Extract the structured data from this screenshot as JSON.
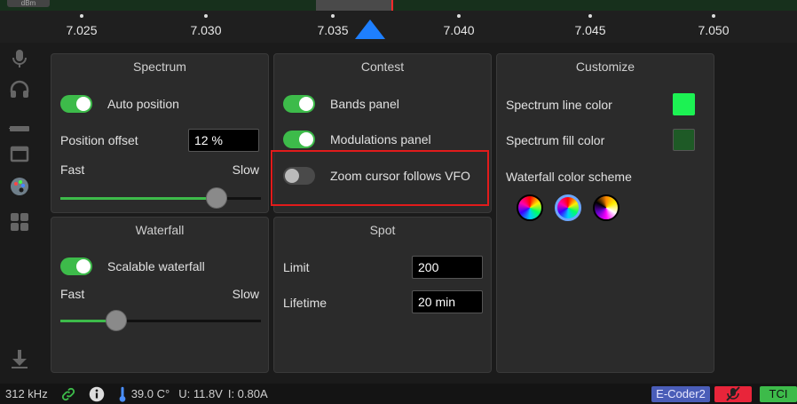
{
  "ruler": {
    "dbm_label": "dBm",
    "ticks": [
      "7.025",
      "7.030",
      "7.035",
      "7.040",
      "7.045",
      "7.050"
    ]
  },
  "spectrum": {
    "title": "Spectrum",
    "auto_position_label": "Auto position",
    "auto_position_on": true,
    "position_offset_label": "Position offset",
    "position_offset_value": "12 %",
    "speed_fast": "Fast",
    "speed_slow": "Slow",
    "speed_level": 0.78
  },
  "contest": {
    "title": "Contest",
    "bands_panel_label": "Bands panel",
    "bands_panel_on": true,
    "modulations_panel_label": "Modulations panel",
    "modulations_panel_on": true,
    "zoom_cursor_label": "Zoom cursor follows VFO",
    "zoom_cursor_on": false
  },
  "customize": {
    "title": "Customize",
    "line_color_label": "Spectrum line color",
    "line_color": "#1cf253",
    "fill_color_label": "Spectrum fill color",
    "fill_color": "#1e5a26",
    "waterfall_scheme_label": "Waterfall color scheme",
    "selected_scheme": 2
  },
  "waterfall": {
    "title": "Waterfall",
    "scalable_label": "Scalable waterfall",
    "scalable_on": true,
    "speed_fast": "Fast",
    "speed_slow": "Slow",
    "speed_level": 0.28
  },
  "spot": {
    "title": "Spot",
    "limit_label": "Limit",
    "limit_value": "200",
    "lifetime_label": "Lifetime",
    "lifetime_value": "20 min"
  },
  "status": {
    "bandwidth": "312 kHz",
    "temperature": "39.0 C°",
    "voltage": "U: 11.8V",
    "current": "I: 0.80A",
    "ecoder": "E-Coder2",
    "tci": "TCI"
  },
  "colors": {
    "accent_green": "#3dbb4a",
    "vfo_blue": "#1e7fff",
    "highlight_red": "#e21b1b"
  }
}
